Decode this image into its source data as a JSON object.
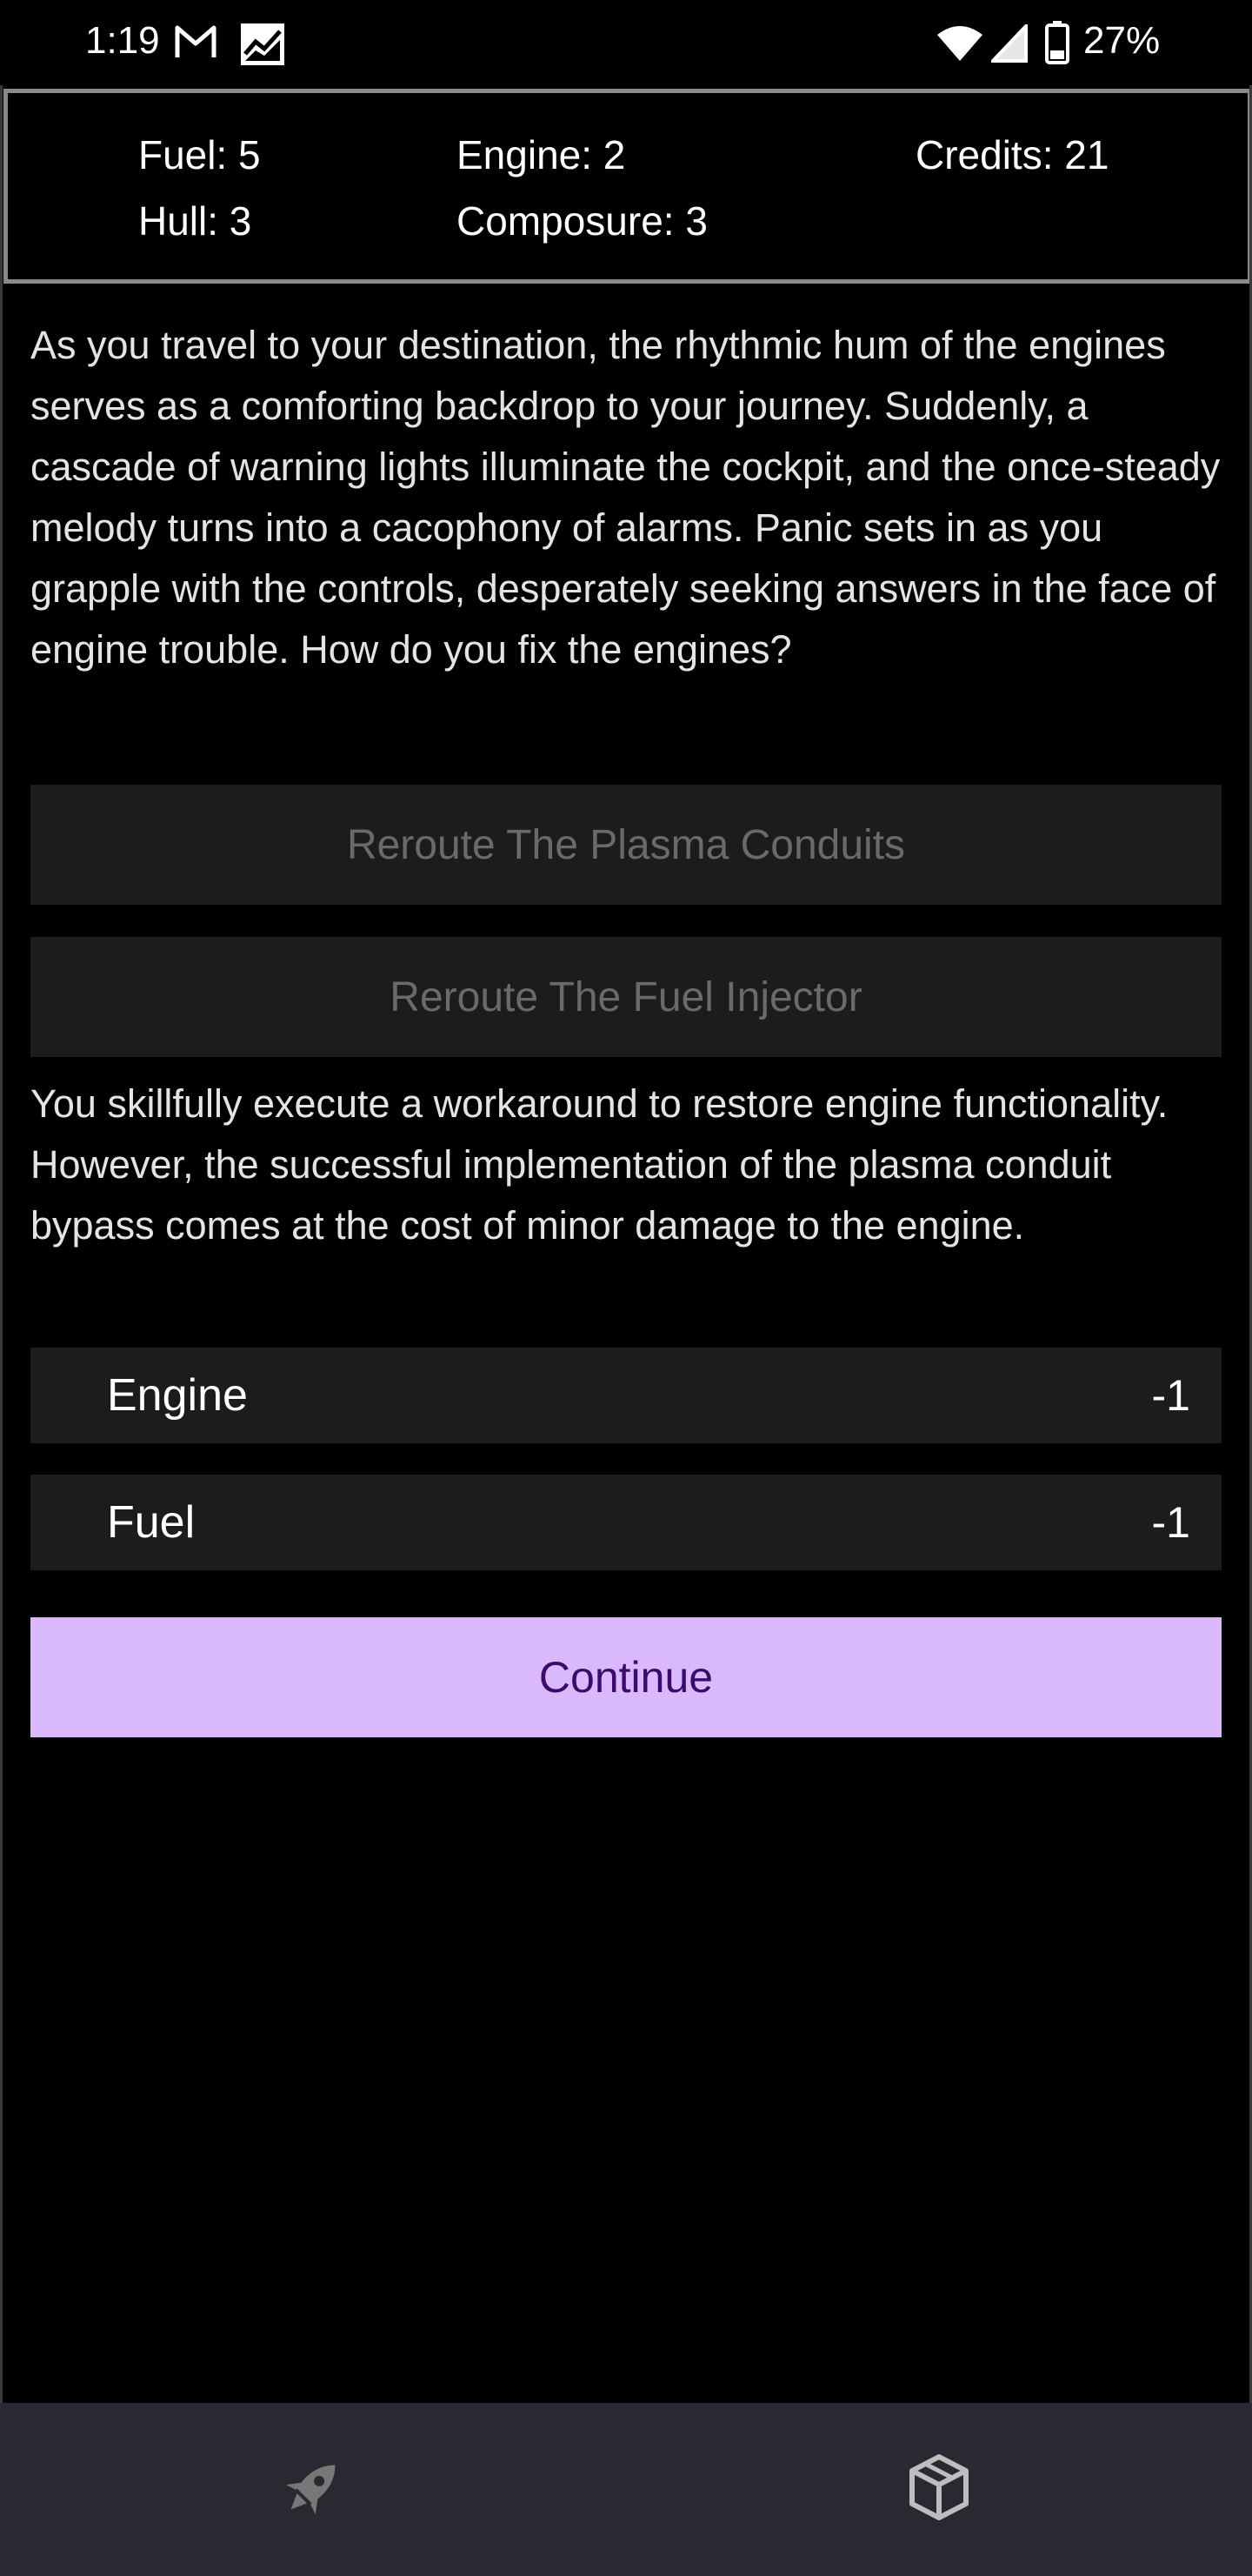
{
  "status_bar": {
    "time": "1:19",
    "battery_percent": "27%",
    "icons": [
      "gmail-icon",
      "chart-app-icon",
      "wifi-icon",
      "signal-icon",
      "battery-icon"
    ]
  },
  "stats": {
    "fuel": "Fuel: 5",
    "hull": "Hull: 3",
    "engine": "Engine: 2",
    "composure": "Composure: 3",
    "credits": "Credits: 21"
  },
  "story": {
    "intro": "As you travel to your destination, the rhythmic hum of the engines serves as a comforting backdrop to your journey. Suddenly, a cascade of warning lights illuminate the cockpit, and the once-steady melody turns into a cacophony of alarms. Panic sets in as you grapple with the controls, desperately seeking answers in the face of engine trouble. How do you fix the engines?",
    "choices": [
      {
        "label": "Reroute The Plasma Conduits"
      },
      {
        "label": "Reroute The Fuel Injector"
      }
    ],
    "outcome": "You skillfully execute a workaround to restore engine functionality. However, the successful implementation of the plasma conduit bypass comes at the cost of minor damage to the engine.",
    "effects": [
      {
        "label": "Engine",
        "value": "-1"
      },
      {
        "label": "Fuel",
        "value": "-1"
      }
    ],
    "continue_label": "Continue"
  },
  "bottom_nav": {
    "items": [
      {
        "icon": "rocket-icon"
      },
      {
        "icon": "cube-icon"
      }
    ]
  },
  "colors": {
    "background": "#000000",
    "panel_border": "#8a8a8a",
    "choice_bg": "#1c1c1c",
    "choice_text_disabled": "#6a6a6a",
    "accent_button": "#d9b8fb",
    "accent_button_text": "#3a0b6b",
    "nav_bg": "#2a2830"
  }
}
